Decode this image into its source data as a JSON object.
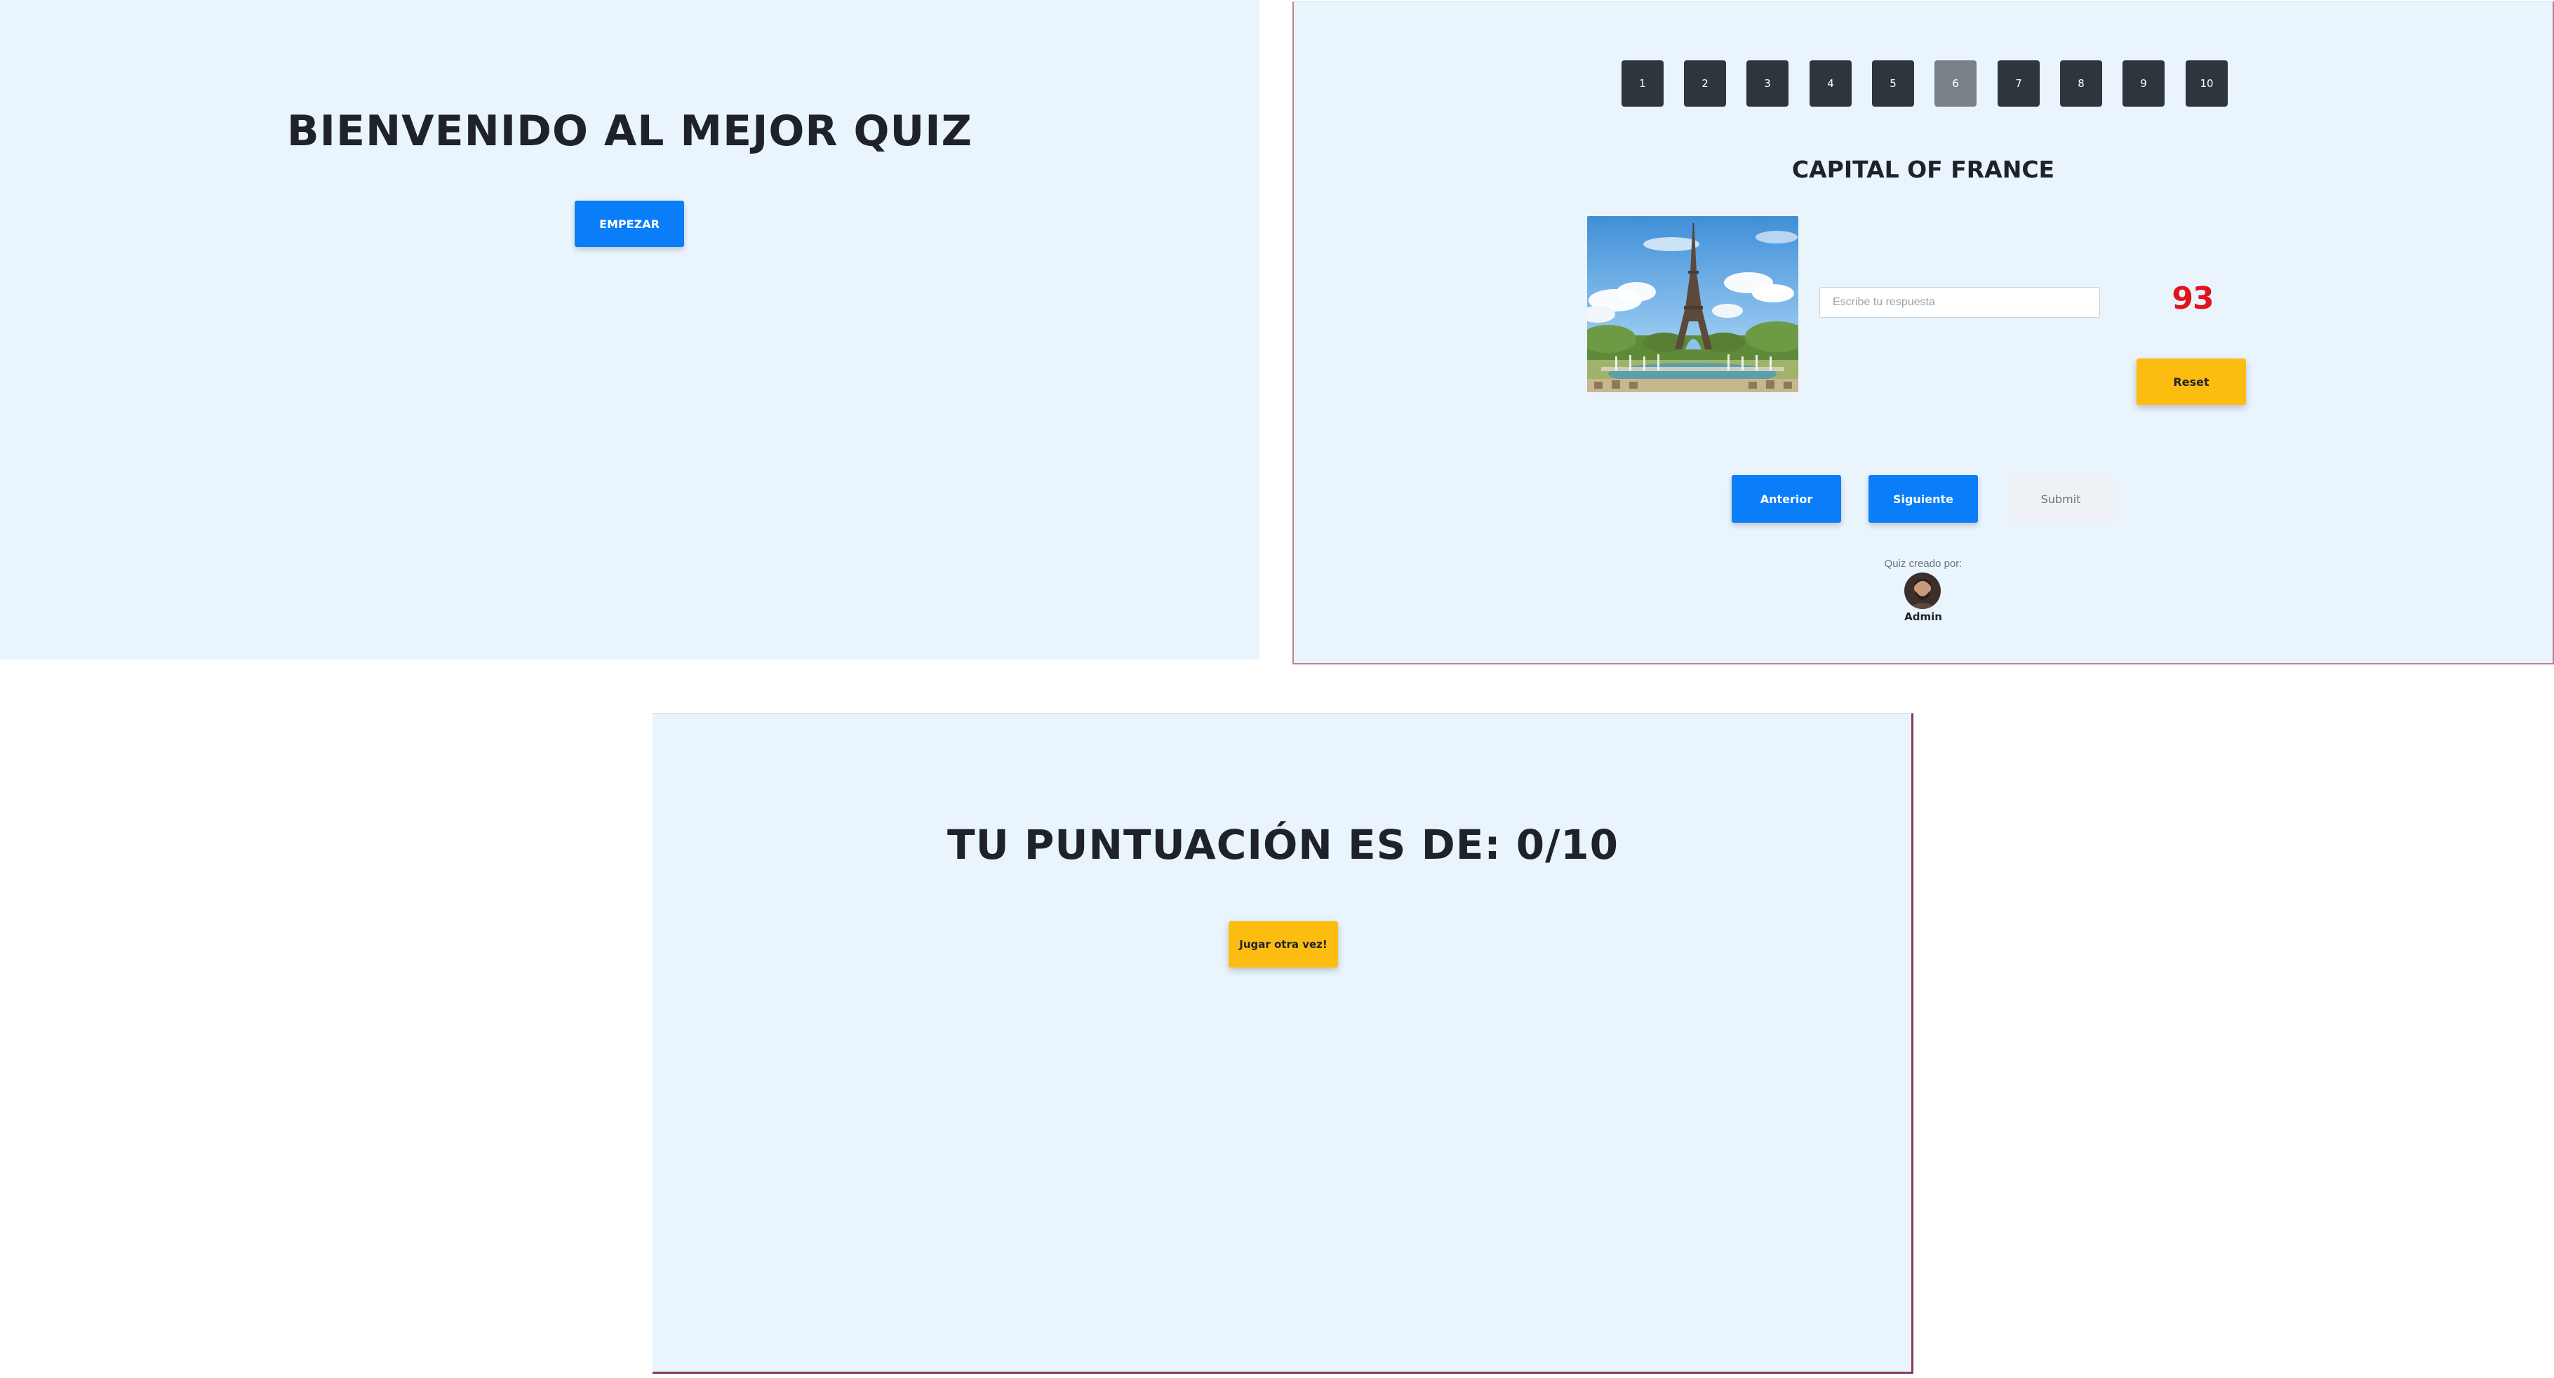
{
  "welcome": {
    "title": "BIENVENIDO AL MEJOR QUIZ",
    "start_label": "EMPEZAR"
  },
  "quiz": {
    "question_numbers": [
      "1",
      "2",
      "3",
      "4",
      "5",
      "6",
      "7",
      "8",
      "9",
      "10"
    ],
    "active_question": "6",
    "question_title": "CAPITAL OF FRANCE",
    "image_subject": "eiffel-tower-photo",
    "answer_placeholder": "Escribe tu respuesta",
    "answer_value": "",
    "timer": "93",
    "reset_label": "Reset",
    "prev_label": "Anterior",
    "next_label": "Siguiente",
    "submit_label": "Submit",
    "author_caption": "Quiz creado por:",
    "author_name": "Admin"
  },
  "result": {
    "title": "TU PUNTUACIÓN ES DE: 0/10",
    "replay_label": "Jugar otra vez!"
  },
  "colors": {
    "panel_bg": "#eaf4fd",
    "primary_blue": "#0a7df8",
    "accent_yellow": "#fdbd10",
    "dark_tile": "#2f353c",
    "active_tile": "#7a8088",
    "timer_red": "#e0141d",
    "text_dark": "#1f2329"
  }
}
